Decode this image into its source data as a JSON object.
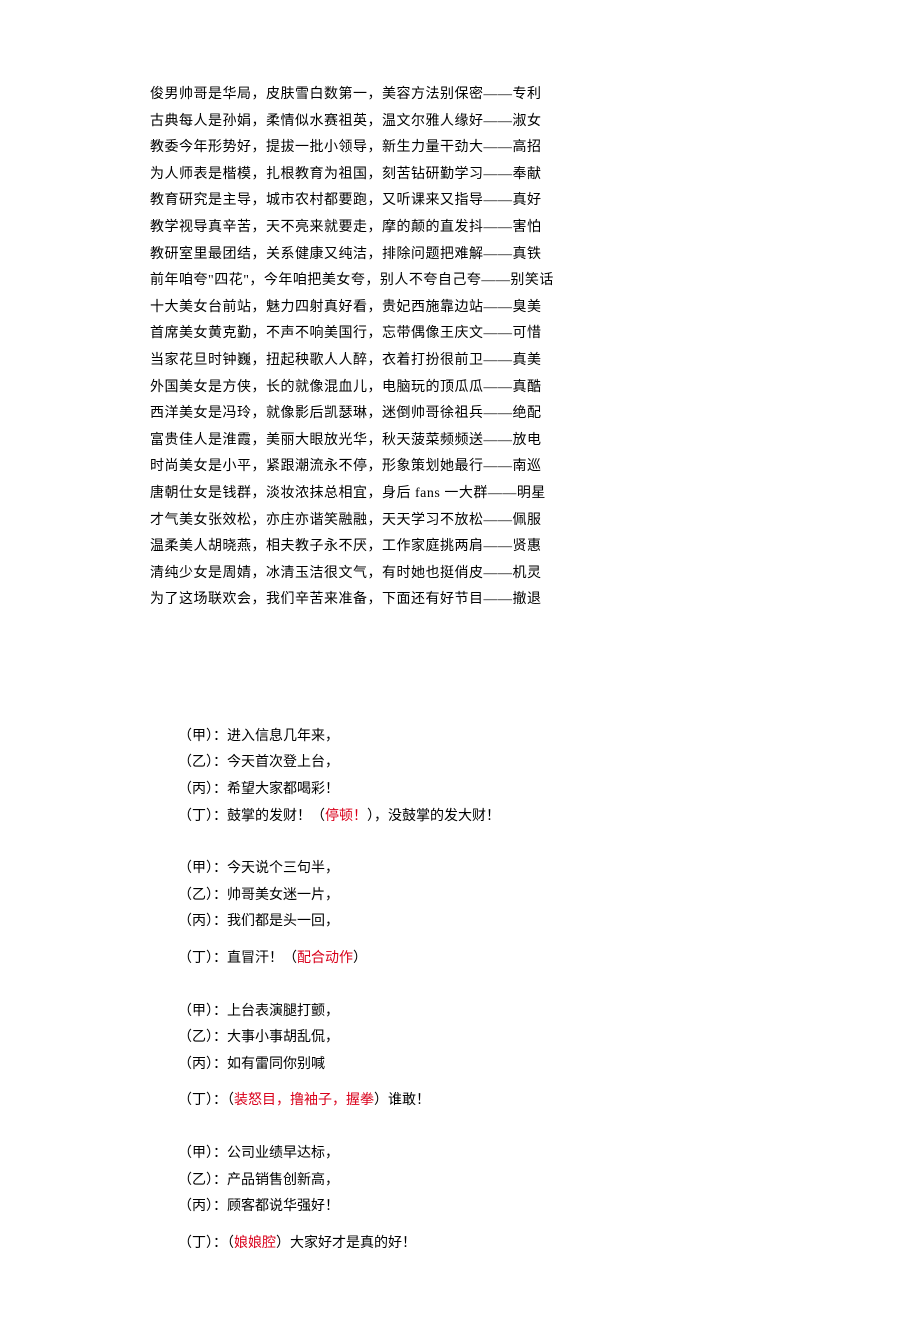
{
  "poem": [
    "俊男帅哥是华局，皮肤雪白数第一，美容方法别保密——专利",
    "古典每人是孙娟，柔情似水赛祖英，温文尔雅人缘好——淑女",
    "教委今年形势好，提拔一批小领导，新生力量干劲大——高招",
    "为人师表是楷模，扎根教育为祖国，刻苦钻研勤学习——奉献",
    "教育研究是主导，城市农村都要跑，又听课来又指导——真好",
    "教学视导真辛苦，天不亮来就要走，摩的颠的直发抖——害怕",
    "教研室里最团结，关系健康又纯洁，排除问题把难解——真铁",
    "前年咱夸\"四花\"，今年咱把美女夸，别人不夸自己夸——别笑话",
    "十大美女台前站，魅力四射真好看，贵妃西施靠边站——臭美",
    "首席美女黄克勤，不声不响美国行，忘带偶像王庆文——可惜",
    "当家花旦时钟巍，扭起秧歌人人醉，衣着打扮很前卫——真美",
    "外国美女是方侠，长的就像混血儿，电脑玩的顶瓜瓜——真酷",
    "西洋美女是冯玲，就像影后凯瑟琳，迷倒帅哥徐祖兵——绝配",
    "富贵佳人是淮霞，美丽大眼放光华，秋天菠菜频频送——放电",
    "时尚美女是小平，紧跟潮流永不停，形象策划她最行——南巡",
    "唐朝仕女是钱群，淡妆浓抹总相宜，身后 fans 一大群——明星",
    "才气美女张效松，亦庄亦谐笑融融，天天学习不放松——佩服",
    "温柔美人胡晓燕，相夫教子永不厌，工作家庭挑两肩——贤惠",
    "清纯少女是周婧，冰清玉洁很文气，有时她也挺俏皮——机灵",
    "为了这场联欢会，我们辛苦来准备，下面还有好节目——撤退"
  ],
  "dialog": [
    {
      "lines": [
        {
          "speaker": "（甲）",
          "segments": [
            {
              "text": "：进入信息几年来，"
            }
          ]
        },
        {
          "speaker": "（乙）",
          "segments": [
            {
              "text": "：今天首次登上台，"
            }
          ]
        },
        {
          "speaker": "（丙）",
          "segments": [
            {
              "text": "：希望大家都喝彩！"
            }
          ]
        },
        {
          "speaker": "（丁）",
          "segments": [
            {
              "text": "：鼓掌的发财！（"
            },
            {
              "text": "停顿！",
              "red": true
            },
            {
              "text": "），没鼓掌的发大财！"
            }
          ]
        }
      ]
    },
    {
      "lines": [
        {
          "speaker": "（甲）",
          "segments": [
            {
              "text": "：今天说个三句半，"
            }
          ]
        },
        {
          "speaker": "（乙）",
          "segments": [
            {
              "text": "：帅哥美女迷一片，"
            }
          ]
        },
        {
          "speaker": "（丙）",
          "segments": [
            {
              "text": "：我们都是头一回，"
            }
          ]
        },
        {
          "speaker": "（丁）",
          "extraGap": true,
          "segments": [
            {
              "text": "：直冒汗！（"
            },
            {
              "text": "配合动作",
              "red": true
            },
            {
              "text": "）"
            }
          ]
        }
      ]
    },
    {
      "lines": [
        {
          "speaker": "（甲）",
          "segments": [
            {
              "text": "：上台表演腿打颤，"
            }
          ]
        },
        {
          "speaker": "（乙）",
          "segments": [
            {
              "text": "：大事小事胡乱侃，"
            }
          ]
        },
        {
          "speaker": "（丙）",
          "segments": [
            {
              "text": "：如有雷同你别喊"
            }
          ]
        },
        {
          "speaker": "（丁）",
          "extraGap": true,
          "segments": [
            {
              "text": "：（"
            },
            {
              "text": "装怒目，撸袖子，握拳",
              "red": true
            },
            {
              "text": "）谁敢！"
            }
          ]
        }
      ]
    },
    {
      "lines": [
        {
          "speaker": "（甲）",
          "segments": [
            {
              "text": "：公司业绩早达标，"
            }
          ]
        },
        {
          "speaker": "（乙）",
          "segments": [
            {
              "text": "：产品销售创新高，"
            }
          ]
        },
        {
          "speaker": "（丙）",
          "segments": [
            {
              "text": "：顾客都说华强好！"
            }
          ]
        },
        {
          "speaker": "（丁）",
          "extraGap": true,
          "segments": [
            {
              "text": "：（"
            },
            {
              "text": "娘娘腔",
              "red": true
            },
            {
              "text": "）大家好才是真的好！"
            }
          ]
        }
      ]
    }
  ]
}
